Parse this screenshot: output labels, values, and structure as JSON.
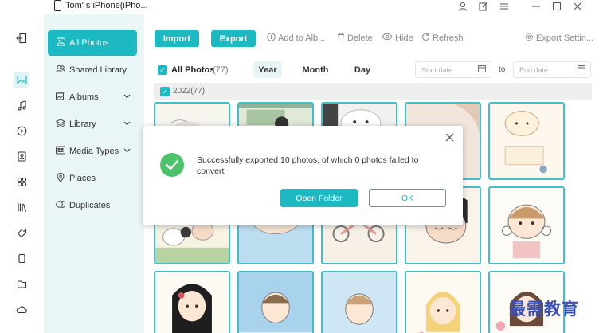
{
  "window": {
    "title": "Tom' s iPhone(iPho...",
    "controls": [
      "user-icon",
      "edit-icon",
      "menu-icon",
      "minimize-icon",
      "maximize-icon",
      "close-icon"
    ]
  },
  "rail": {
    "items": [
      "back-icon",
      "photos-icon",
      "music-icon",
      "video-icon",
      "contacts-icon",
      "apps-icon",
      "books-icon",
      "tag-icon",
      "device-icon",
      "folder-icon",
      "cloud-icon"
    ]
  },
  "nav": {
    "items": [
      {
        "label": "All Photos"
      },
      {
        "label": "Shared Library"
      },
      {
        "label": "Albums"
      },
      {
        "label": "Library"
      },
      {
        "label": "Media Types"
      },
      {
        "label": "Places"
      },
      {
        "label": "Duplicates"
      }
    ]
  },
  "toolbar": {
    "import": "Import",
    "export": "Export",
    "add_to_album": "Add to Alb...",
    "delete": "Delete",
    "hide": "Hide",
    "refresh": "Refresh",
    "export_settings": "Export Settin..."
  },
  "filter": {
    "all_photos": "All Photos",
    "count": "(77)",
    "year": "Year",
    "month": "Month",
    "day": "Day",
    "start_placeholder": "Start date",
    "to": "to",
    "end_placeholder": "End date"
  },
  "group": {
    "label": "2022(77)"
  },
  "dialog": {
    "message": "Successfully exported 10 photos, of which 0 photos failed to convert",
    "open_folder": "Open Folder",
    "ok": "OK"
  },
  "watermark": "最需教育",
  "colors": {
    "accent": "#1cb9c3",
    "success": "#4cc26a",
    "nav_bg": "#eaf5f6"
  }
}
